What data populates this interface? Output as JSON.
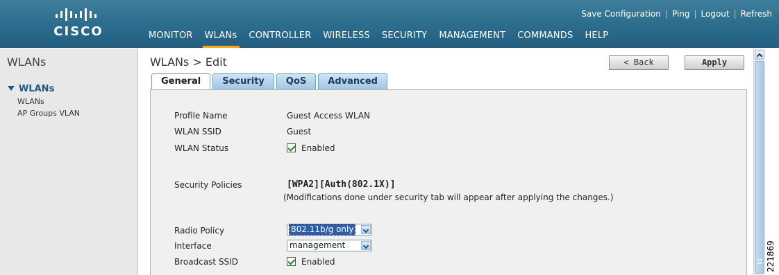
{
  "header": {
    "logo_text": "CISCO",
    "top_links": [
      "Save Configuration",
      "Ping",
      "Logout",
      "Refresh"
    ],
    "nav": [
      "MONITOR",
      "WLANs",
      "CONTROLLER",
      "WIRELESS",
      "SECURITY",
      "MANAGEMENT",
      "COMMANDS",
      "HELP"
    ],
    "active_nav": "WLANs",
    "accent_color": "#f3a51c",
    "bar_color": "#2b6c8c"
  },
  "sidebar": {
    "title": "WLANs",
    "group": "WLANs",
    "items": [
      "WLANs",
      "AP Groups VLAN"
    ]
  },
  "main": {
    "title": "WLANs > Edit",
    "back_label": "< Back",
    "apply_label": "Apply",
    "tabs": [
      "General",
      "Security",
      "QoS",
      "Advanced"
    ],
    "active_tab": "General",
    "fields": {
      "profile_name_label": "Profile Name",
      "profile_name_value": "Guest Access WLAN",
      "ssid_label": "WLAN SSID",
      "ssid_value": "Guest",
      "status_label": "WLAN Status",
      "status_value": "Enabled",
      "security_label": "Security Policies",
      "security_value": "[WPA2][Auth(802.1X)]",
      "security_note": "(Modifications done under security tab will appear after applying the changes.)",
      "radio_label": "Radio Policy",
      "radio_value": "802.11b/g only",
      "interface_label": "Interface",
      "interface_value": "management",
      "broadcast_label": "Broadcast SSID",
      "broadcast_value": "Enabled"
    }
  },
  "figure_id": "221869"
}
